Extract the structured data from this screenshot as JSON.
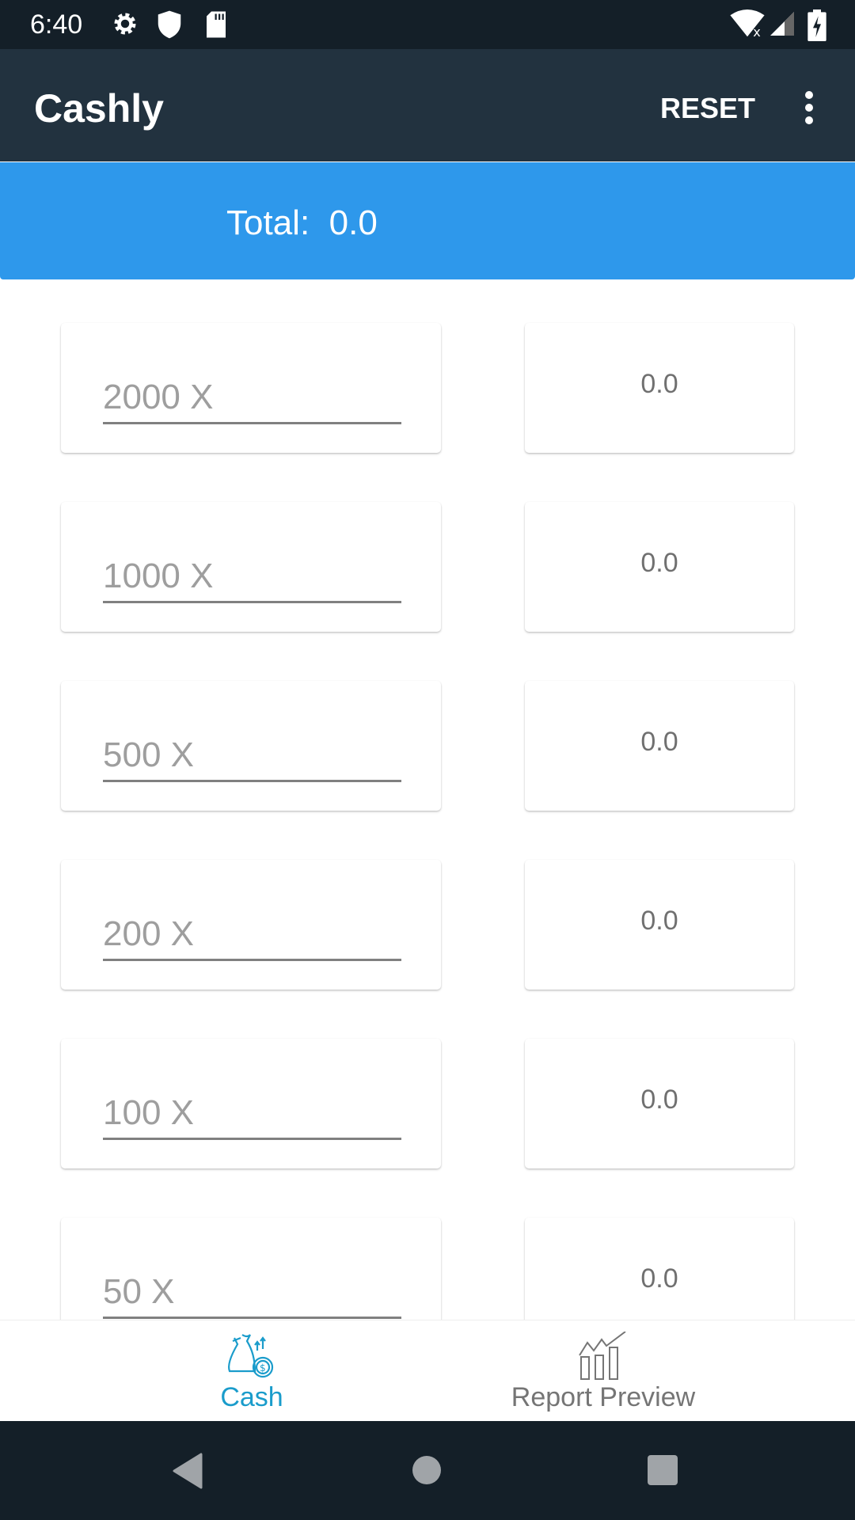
{
  "status_bar": {
    "time": "6:40",
    "icons": [
      "gear-icon",
      "shield-icon",
      "sd-card-icon",
      "wifi-off-icon",
      "signal-icon",
      "battery-charging-icon"
    ]
  },
  "app_bar": {
    "title": "Cashly",
    "reset_label": "RESET",
    "menu_icon": "more-vert-icon"
  },
  "summary": {
    "total_label": "Total:",
    "total_value": "0.0"
  },
  "denominations": [
    {
      "placeholder": "2000 X",
      "value": "0.0"
    },
    {
      "placeholder": "1000 X",
      "value": "0.0"
    },
    {
      "placeholder": "500 X",
      "value": "0.0"
    },
    {
      "placeholder": "200 X",
      "value": "0.0"
    },
    {
      "placeholder": "100 X",
      "value": "0.0"
    },
    {
      "placeholder": "50 X",
      "value": "0.0"
    }
  ],
  "bottom_nav": {
    "items": [
      {
        "label": "Cash",
        "icon": "money-bag-icon",
        "active": true
      },
      {
        "label": "Report Preview",
        "icon": "bar-chart-icon",
        "active": false
      }
    ],
    "active_color": "#1a9ccb",
    "inactive_color": "#757575"
  },
  "colors": {
    "app_bar": "#22323f",
    "banner": "#2e98eb",
    "status_bar": "#141f28"
  }
}
